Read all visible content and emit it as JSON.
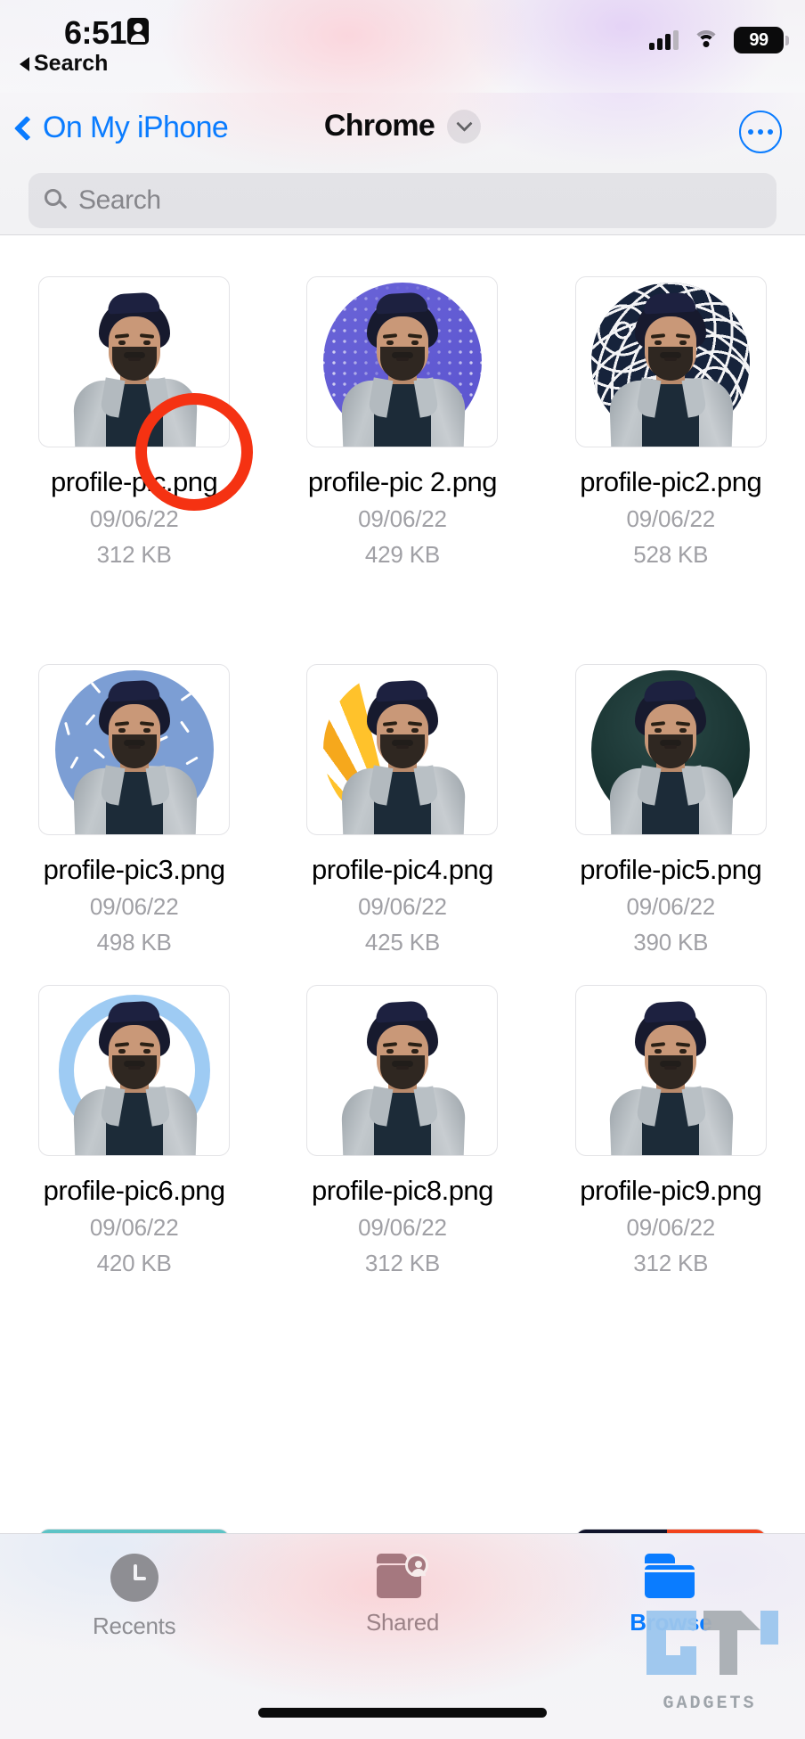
{
  "status_bar": {
    "time": "6:51",
    "location_icon": "location-arrow-icon",
    "back_label": "Search",
    "signal_icon": "cellular-signal-icon",
    "wifi_icon": "wifi-icon",
    "battery_level": "99"
  },
  "nav": {
    "back_label": "On My iPhone",
    "title": "Chrome",
    "caret_icon": "chevron-down-icon",
    "more_icon": "more-options-icon"
  },
  "search": {
    "placeholder": "Search",
    "value": "",
    "icon": "search-icon"
  },
  "files": [
    {
      "name": "profile-pic.png",
      "date": "09/06/22",
      "size": "312 KB",
      "style": "plain"
    },
    {
      "name": "profile-pic 2.png",
      "date": "09/06/22",
      "size": "429 KB",
      "style": "dots"
    },
    {
      "name": "profile-pic2.png",
      "date": "09/06/22",
      "size": "528 KB",
      "style": "maze"
    },
    {
      "name": "profile-pic3.png",
      "date": "09/06/22",
      "size": "498 KB",
      "style": "confetti"
    },
    {
      "name": "profile-pic4.png",
      "date": "09/06/22",
      "size": "425 KB",
      "style": "sunburst"
    },
    {
      "name": "profile-pic5.png",
      "date": "09/06/22",
      "size": "390 KB",
      "style": "dark"
    },
    {
      "name": "profile-pic6.png",
      "date": "09/06/22",
      "size": "420 KB",
      "style": "ring"
    },
    {
      "name": "profile-pic8.png",
      "date": "09/06/22",
      "size": "312 KB",
      "style": "plain"
    },
    {
      "name": "profile-pic9.png",
      "date": "09/06/22",
      "size": "312 KB",
      "style": "plain"
    }
  ],
  "annotation": {
    "shape": "circle-highlight",
    "color": "#f53212",
    "targets": "profile-pic.png"
  },
  "tabs": [
    {
      "label": "Recents",
      "icon": "clock-icon",
      "active": false
    },
    {
      "label": "Shared",
      "icon": "shared-folder-icon",
      "active": false
    },
    {
      "label": "Browse",
      "icon": "folder-icon",
      "active": true
    }
  ],
  "watermark": {
    "text": "GADGETS"
  },
  "colors": {
    "accent": "#0a7cff",
    "annotation": "#f53212",
    "inactive_tab": "#8e8e93",
    "meta_text": "#a0a0a5"
  }
}
